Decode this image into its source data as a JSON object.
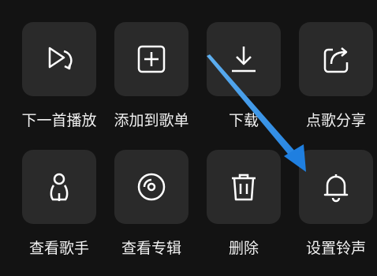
{
  "menu": {
    "items": [
      {
        "label": "下一首播放",
        "icon": "play-next-icon"
      },
      {
        "label": "添加到歌单",
        "icon": "add-to-playlist-icon"
      },
      {
        "label": "下载",
        "icon": "download-icon"
      },
      {
        "label": "点歌分享",
        "icon": "share-icon"
      },
      {
        "label": "查看歌手",
        "icon": "singer-icon"
      },
      {
        "label": "查看专辑",
        "icon": "album-icon"
      },
      {
        "label": "删除",
        "icon": "trash-icon"
      },
      {
        "label": "设置铃声",
        "icon": "bell-icon"
      }
    ]
  },
  "colors": {
    "background": "#131313",
    "tile": "#2a2a2a",
    "text": "#f2f2f2",
    "annotation_arrow": "#2e8fe6"
  }
}
